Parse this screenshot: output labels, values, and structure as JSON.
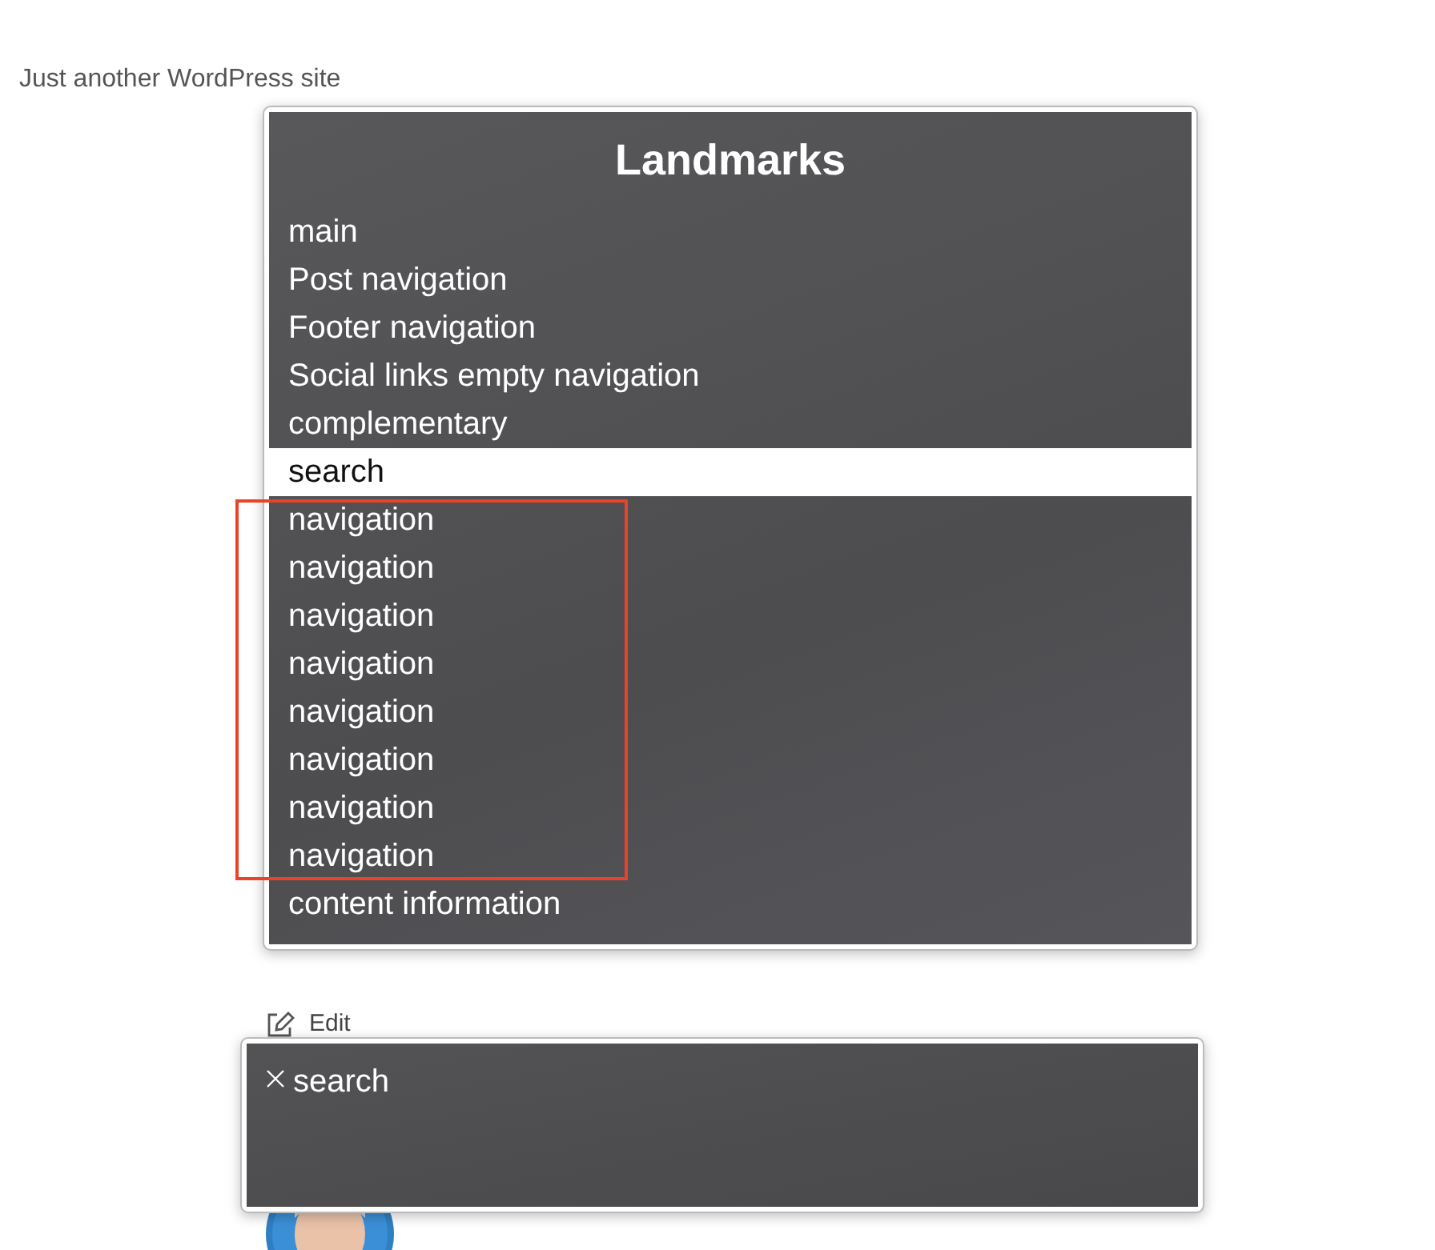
{
  "site": {
    "tagline": "Just another WordPress site",
    "edit_link": "Edit"
  },
  "rotor": {
    "title": "Landmarks",
    "sections": [
      {
        "kind": "plain",
        "items": [
          {
            "label": "main",
            "selected": false
          },
          {
            "label": "Post navigation",
            "selected": false
          },
          {
            "label": "Footer navigation",
            "selected": false
          },
          {
            "label": "Social links empty navigation",
            "selected": false
          },
          {
            "label": "complementary",
            "selected": false
          },
          {
            "label": "search",
            "selected": true
          }
        ]
      },
      {
        "kind": "annotated",
        "items": [
          {
            "label": "navigation",
            "selected": false
          },
          {
            "label": "navigation",
            "selected": false
          },
          {
            "label": "navigation",
            "selected": false
          },
          {
            "label": "navigation",
            "selected": false
          },
          {
            "label": "navigation",
            "selected": false
          },
          {
            "label": "navigation",
            "selected": false
          },
          {
            "label": "navigation",
            "selected": false
          },
          {
            "label": "navigation",
            "selected": false
          }
        ]
      },
      {
        "kind": "plain",
        "items": [
          {
            "label": "content information",
            "selected": false
          }
        ]
      }
    ]
  },
  "caption": {
    "text": "search"
  }
}
